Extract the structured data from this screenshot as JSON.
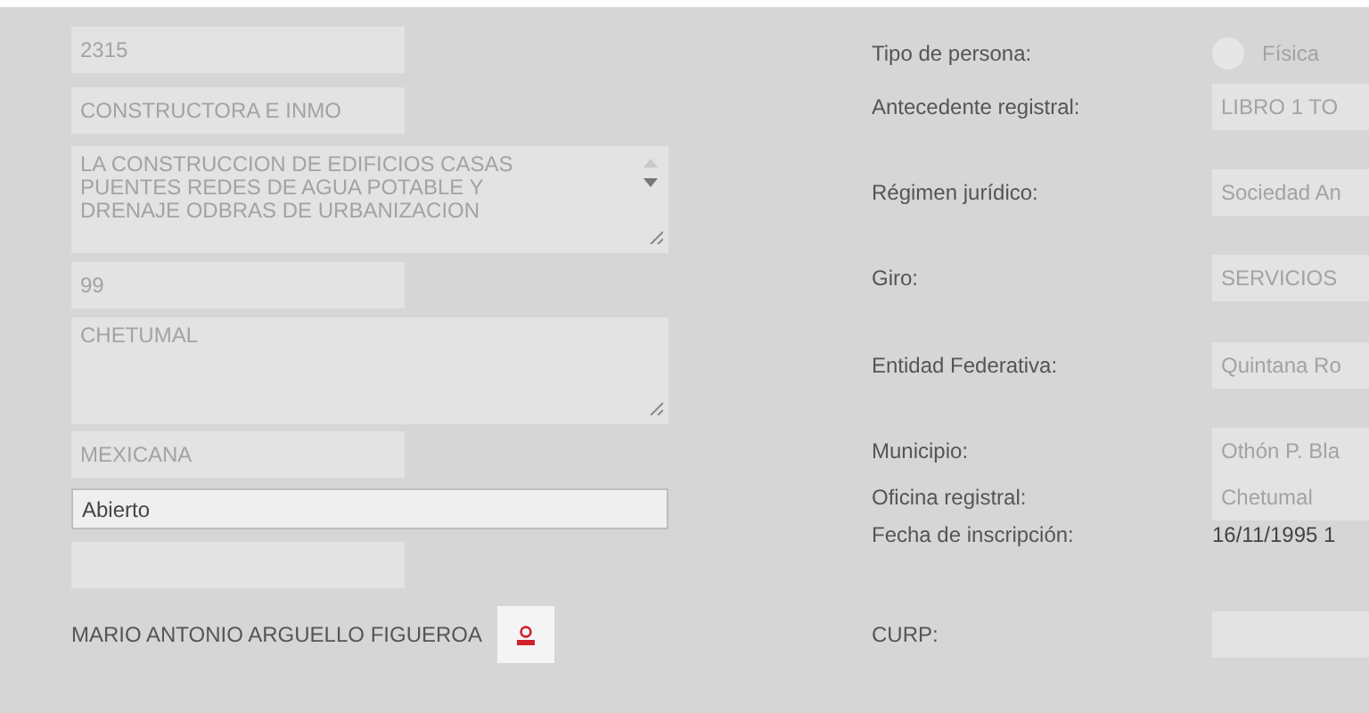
{
  "left_fields": [
    {
      "kind": "input",
      "value": "2315",
      "disabled": true
    },
    {
      "kind": "input",
      "value": "CONSTRUCTORA E INMO",
      "disabled": true
    },
    {
      "kind": "textarea",
      "value": "LA CONSTRUCCION DE EDIFICIOS CASAS PUENTES REDES DE AGUA POTABLE  Y DRENAJE ODBRAS DE URBANIZACION",
      "disabled": true,
      "scrollbar": true
    },
    {
      "kind": "input",
      "value": "99",
      "disabled": true
    },
    {
      "kind": "textarea",
      "value": "CHETUMAL",
      "disabled": true,
      "scrollbar": false
    },
    {
      "kind": "input",
      "value": "MEXICANA",
      "disabled": true
    },
    {
      "kind": "input",
      "value": "Abierto",
      "disabled": false
    },
    {
      "kind": "input",
      "disabled": true
    },
    {
      "kind": "person",
      "value": "MARIO ANTONIO ARGUELLO FIGUEROA"
    }
  ],
  "right_fields": [
    {
      "label": "Tipo de persona:",
      "kind": "radio",
      "value": "Física",
      "checked": false
    },
    {
      "label": "Antecedente registral:",
      "kind": "input",
      "value": "LIBRO 1 TO"
    },
    {
      "label": "Régimen jurídico:",
      "kind": "input",
      "value": "Sociedad An"
    },
    {
      "label": "Giro:",
      "kind": "input",
      "value": "SERVICIOS"
    },
    {
      "label": "Entidad Federativa:",
      "kind": "input",
      "value": "Quintana Ro"
    },
    {
      "label": "Municipio:",
      "kind": "input",
      "value": "Othón P. Bla"
    },
    {
      "label": "Oficina registral:",
      "kind": "input",
      "value": "Chetumal"
    },
    {
      "label": "Fecha de inscripción:",
      "kind": "text",
      "value": "16/11/1995 1"
    },
    {
      "label": "CURP:",
      "kind": "input"
    }
  ]
}
